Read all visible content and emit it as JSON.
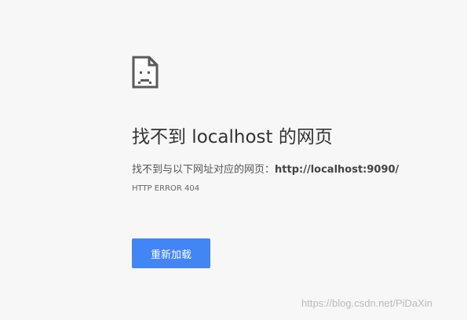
{
  "error_page": {
    "icon": "sad-document-icon",
    "heading": "找不到 localhost 的网页",
    "description_prefix": "找不到与以下网址对应的网页：",
    "url": "http://localhost:9090/",
    "error_code": "HTTP ERROR 404",
    "reload_label": "重新加载"
  },
  "watermark": {
    "text": "https://blog.csdn.net/PiDaXin"
  },
  "colors": {
    "background": "#f7f7f7",
    "button": "#4285f4",
    "button_text": "#ffffff",
    "heading_text": "#333333"
  }
}
